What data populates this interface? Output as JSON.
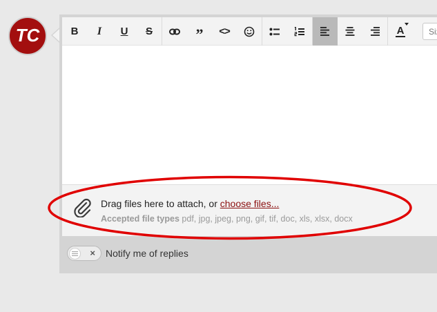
{
  "brand": {
    "monogram": "TC",
    "color": "#a30f0f"
  },
  "toolbar": {
    "groups": [
      [
        {
          "name": "bold",
          "glyph": "B"
        },
        {
          "name": "italic",
          "glyph": "I"
        },
        {
          "name": "underline",
          "glyph": "U"
        },
        {
          "name": "strikethrough",
          "glyph": "S"
        }
      ],
      [
        {
          "name": "link",
          "icon": "link-icon"
        },
        {
          "name": "quote",
          "glyph": "”"
        },
        {
          "name": "code",
          "glyph": "<>"
        },
        {
          "name": "emoji",
          "icon": "smiley-icon"
        }
      ],
      [
        {
          "name": "bullet-list",
          "icon": "bullet-list-icon"
        },
        {
          "name": "numbered-list",
          "icon": "numbered-list-icon"
        }
      ],
      [
        {
          "name": "align-left",
          "icon": "align-left-icon",
          "active": true
        },
        {
          "name": "align-center",
          "icon": "align-center-icon"
        },
        {
          "name": "align-right",
          "icon": "align-right-icon"
        }
      ],
      [
        {
          "name": "text-color",
          "glyph": "A"
        }
      ]
    ],
    "size_label": "Size"
  },
  "attach": {
    "prompt": "Drag files here to attach, or ",
    "choose_link": "choose files...",
    "accepted_label": "Accepted file types",
    "accepted_types": " pdf, jpg, jpeg, png, gif, tif, doc, xls, xlsx, docx",
    "link_color": "#8b0f0f"
  },
  "notify": {
    "label": "Notify me of replies",
    "enabled": false
  },
  "highlight": {
    "color": "#e00000"
  }
}
